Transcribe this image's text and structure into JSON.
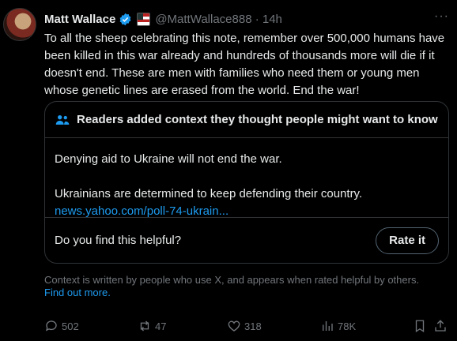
{
  "tweet": {
    "author_name": "Matt Wallace",
    "handle_time": "@MattWallace888 · 14h",
    "more": "···",
    "text": "To all the sheep celebrating this note, remember over 500,000 humans have been killed in this war already and hundreds of thousands more will die if it doesn't end. These are men with families who need them or young men whose genetic lines are erased from the world. End the war!"
  },
  "note": {
    "header": "Readers added context they thought people might want to know",
    "line1": "Denying aid to Ukraine will not end the war.",
    "line2": "Ukrainians are determined to keep defending their country.",
    "link": "news.yahoo.com/poll-74-ukrain...",
    "question": "Do you find this helpful?",
    "rate_label": "Rate it"
  },
  "disclaimer": {
    "text": "Context is written by people who use X, and appears when rated helpful by others.",
    "link": "Find out more."
  },
  "actions": {
    "replies": "502",
    "reposts": "47",
    "likes": "318",
    "views": "78K"
  },
  "colors": {
    "accent": "#1d9bf0",
    "muted": "#71767b",
    "text": "#e7e9ea",
    "border": "#2f3336"
  }
}
